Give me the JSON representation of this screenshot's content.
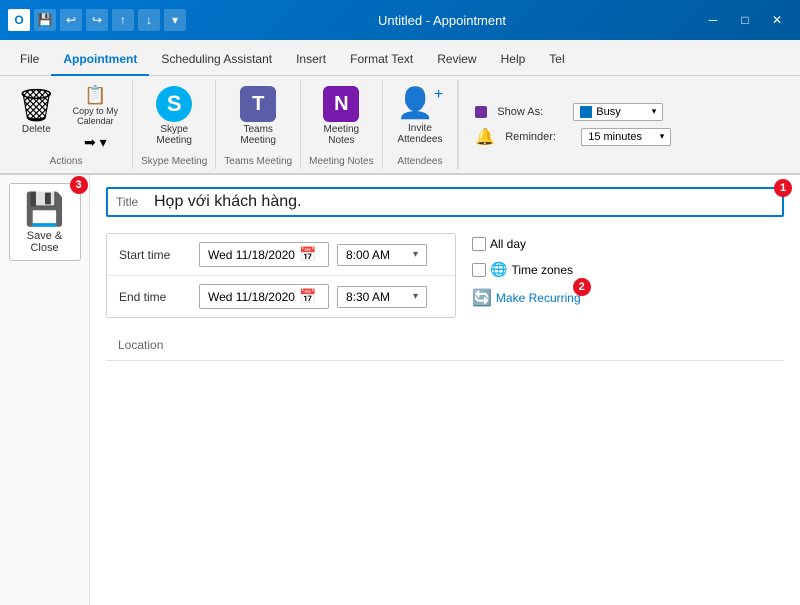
{
  "titleBar": {
    "title": "Untitled - Appointment",
    "saveIcon": "💾",
    "undoIcon": "↩",
    "redoIcon": "↪",
    "upIcon": "↑",
    "downIcon": "↓",
    "dropdownIcon": "▾"
  },
  "tabs": [
    {
      "label": "File",
      "active": false
    },
    {
      "label": "Appointment",
      "active": true
    },
    {
      "label": "Scheduling Assistant",
      "active": false
    },
    {
      "label": "Insert",
      "active": false
    },
    {
      "label": "Format Text",
      "active": false
    },
    {
      "label": "Review",
      "active": false
    },
    {
      "label": "Help",
      "active": false
    },
    {
      "label": "Tel",
      "active": false
    }
  ],
  "ribbon": {
    "groups": [
      {
        "name": "Actions",
        "items": [
          {
            "icon": "🗑",
            "label": "Delete"
          },
          {
            "icon": "📋",
            "label": "Copy to My\nCalendar"
          },
          {
            "icon": "→",
            "label": ""
          }
        ]
      },
      {
        "name": "Skype Meeting",
        "items": [
          {
            "icon": "S",
            "label": "Skype\nMeeting",
            "color": "#00aff0"
          }
        ]
      },
      {
        "name": "Teams Meeting",
        "items": [
          {
            "icon": "T",
            "label": "Teams\nMeeting",
            "color": "#5b5ea6"
          }
        ]
      },
      {
        "name": "Meeting Notes",
        "items": [
          {
            "icon": "N",
            "label": "Meeting\nNotes",
            "color": "#7719aa"
          }
        ]
      },
      {
        "name": "Attendees",
        "items": [
          {
            "icon": "👤",
            "label": "Invite\nAttendees"
          }
        ]
      }
    ],
    "options": {
      "showAsLabel": "Show As:",
      "showAsValue": "Busy",
      "reminderLabel": "Reminder:",
      "reminderValue": "15 minutes"
    }
  },
  "form": {
    "titleLabel": "Title",
    "titleValue": "Họp với khách hàng.",
    "startTimeLabel": "Start time",
    "startDate": "Wed 11/18/2020",
    "startTime": "8:00 AM",
    "endTimeLabel": "End time",
    "endDate": "Wed 11/18/2020",
    "endTime": "8:30 AM",
    "allDayLabel": "All day",
    "timeZonesLabel": "Time zones",
    "makeRecurringLabel": "Make Recurring",
    "locationLabel": "Location"
  },
  "saveClose": {
    "label": "Save &\nClose"
  },
  "badges": {
    "badge1": "1",
    "badge2": "2",
    "badge3": "3"
  }
}
